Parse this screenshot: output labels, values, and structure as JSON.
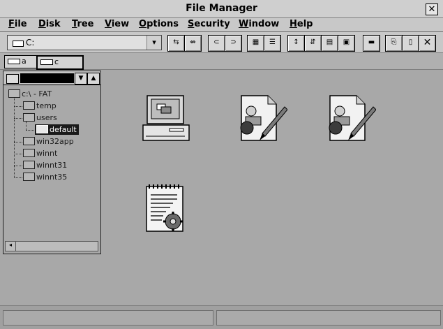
{
  "window": {
    "title": "File Manager",
    "close_glyph": "✕"
  },
  "menu": [
    "File",
    "Disk",
    "Tree",
    "View",
    "Options",
    "Security",
    "Window",
    "Help"
  ],
  "toolbar": {
    "drive_value": "C:",
    "dropdown_glyph": "▾",
    "buttons": [
      {
        "name": "connect-net-drive-icon",
        "glyph": "⇆"
      },
      {
        "name": "disconnect-net-drive-icon",
        "glyph": "⇎"
      },
      {
        "name": "share-as-icon",
        "glyph": "⊂"
      },
      {
        "name": "stop-sharing-icon",
        "glyph": "⊃"
      },
      {
        "name": "large-icons-view-icon",
        "glyph": "▦"
      },
      {
        "name": "details-view-icon",
        "glyph": "☰"
      },
      {
        "name": "sort-by-name-icon",
        "glyph": "↕"
      },
      {
        "name": "sort-by-type-icon",
        "glyph": "⇵"
      },
      {
        "name": "sort-by-size-icon",
        "glyph": "▤"
      },
      {
        "name": "sort-by-date-icon",
        "glyph": "▣"
      },
      {
        "name": "minimize-icon",
        "glyph": "▬"
      },
      {
        "name": "copy-icon",
        "glyph": "⎘"
      },
      {
        "name": "paste-icon",
        "glyph": "▯"
      },
      {
        "name": "delete-icon",
        "glyph": "✕"
      }
    ]
  },
  "drives": [
    {
      "label": "a",
      "icon": "floppy-drive-icon"
    },
    {
      "label": "c",
      "icon": "hard-drive-icon"
    }
  ],
  "tree": {
    "root": "c:\\ - FAT",
    "nodes": [
      {
        "label": "temp",
        "selected": false
      },
      {
        "label": "users",
        "selected": false
      },
      {
        "label": "default",
        "selected": true
      },
      {
        "label": "win32app",
        "selected": false
      },
      {
        "label": "winnt",
        "selected": false
      },
      {
        "label": "winnt31",
        "selected": false
      },
      {
        "label": "winnt35",
        "selected": false
      }
    ]
  },
  "desktop_icons": [
    {
      "name": "my-computer-icon"
    },
    {
      "name": "edit-document-icon"
    },
    {
      "name": "edit-document-icon-2"
    },
    {
      "name": "settings-document-icon"
    }
  ]
}
